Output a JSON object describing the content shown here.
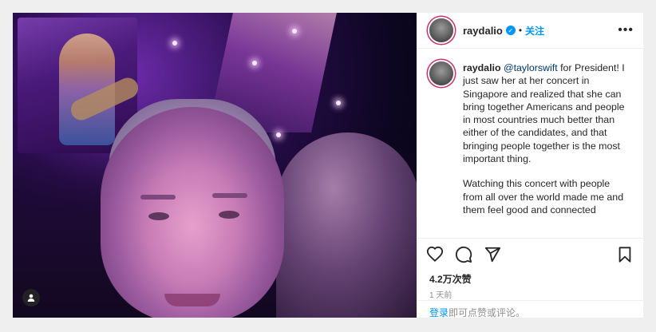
{
  "post": {
    "username": "raydalio",
    "follow_label": "关注",
    "dot": "•",
    "more_icon": "more-horizontal-icon"
  },
  "caption": {
    "username": "raydalio",
    "mention": "@taylorswift",
    "paragraph1_rest": " for President! I just saw her at her concert in Singapore and realized that she can bring together Americans and people in most countries much better than either of the candidates, and that bringing people together is the most important thing.",
    "paragraph2": "Watching this concert with people from all over the world made me and them feel good and connected"
  },
  "actions": {
    "like_icon": "heart-icon",
    "comment_icon": "comment-icon",
    "share_icon": "share-icon",
    "save_icon": "bookmark-icon"
  },
  "stats": {
    "likes": "4.2万次赞",
    "time": "1 天前"
  },
  "footer": {
    "login_link": "登录",
    "rest": "即可点赞或评论。"
  },
  "colors": {
    "accent": "#0095f6",
    "text": "#262626",
    "muted": "#8e8e8e",
    "background": "#efefef"
  }
}
